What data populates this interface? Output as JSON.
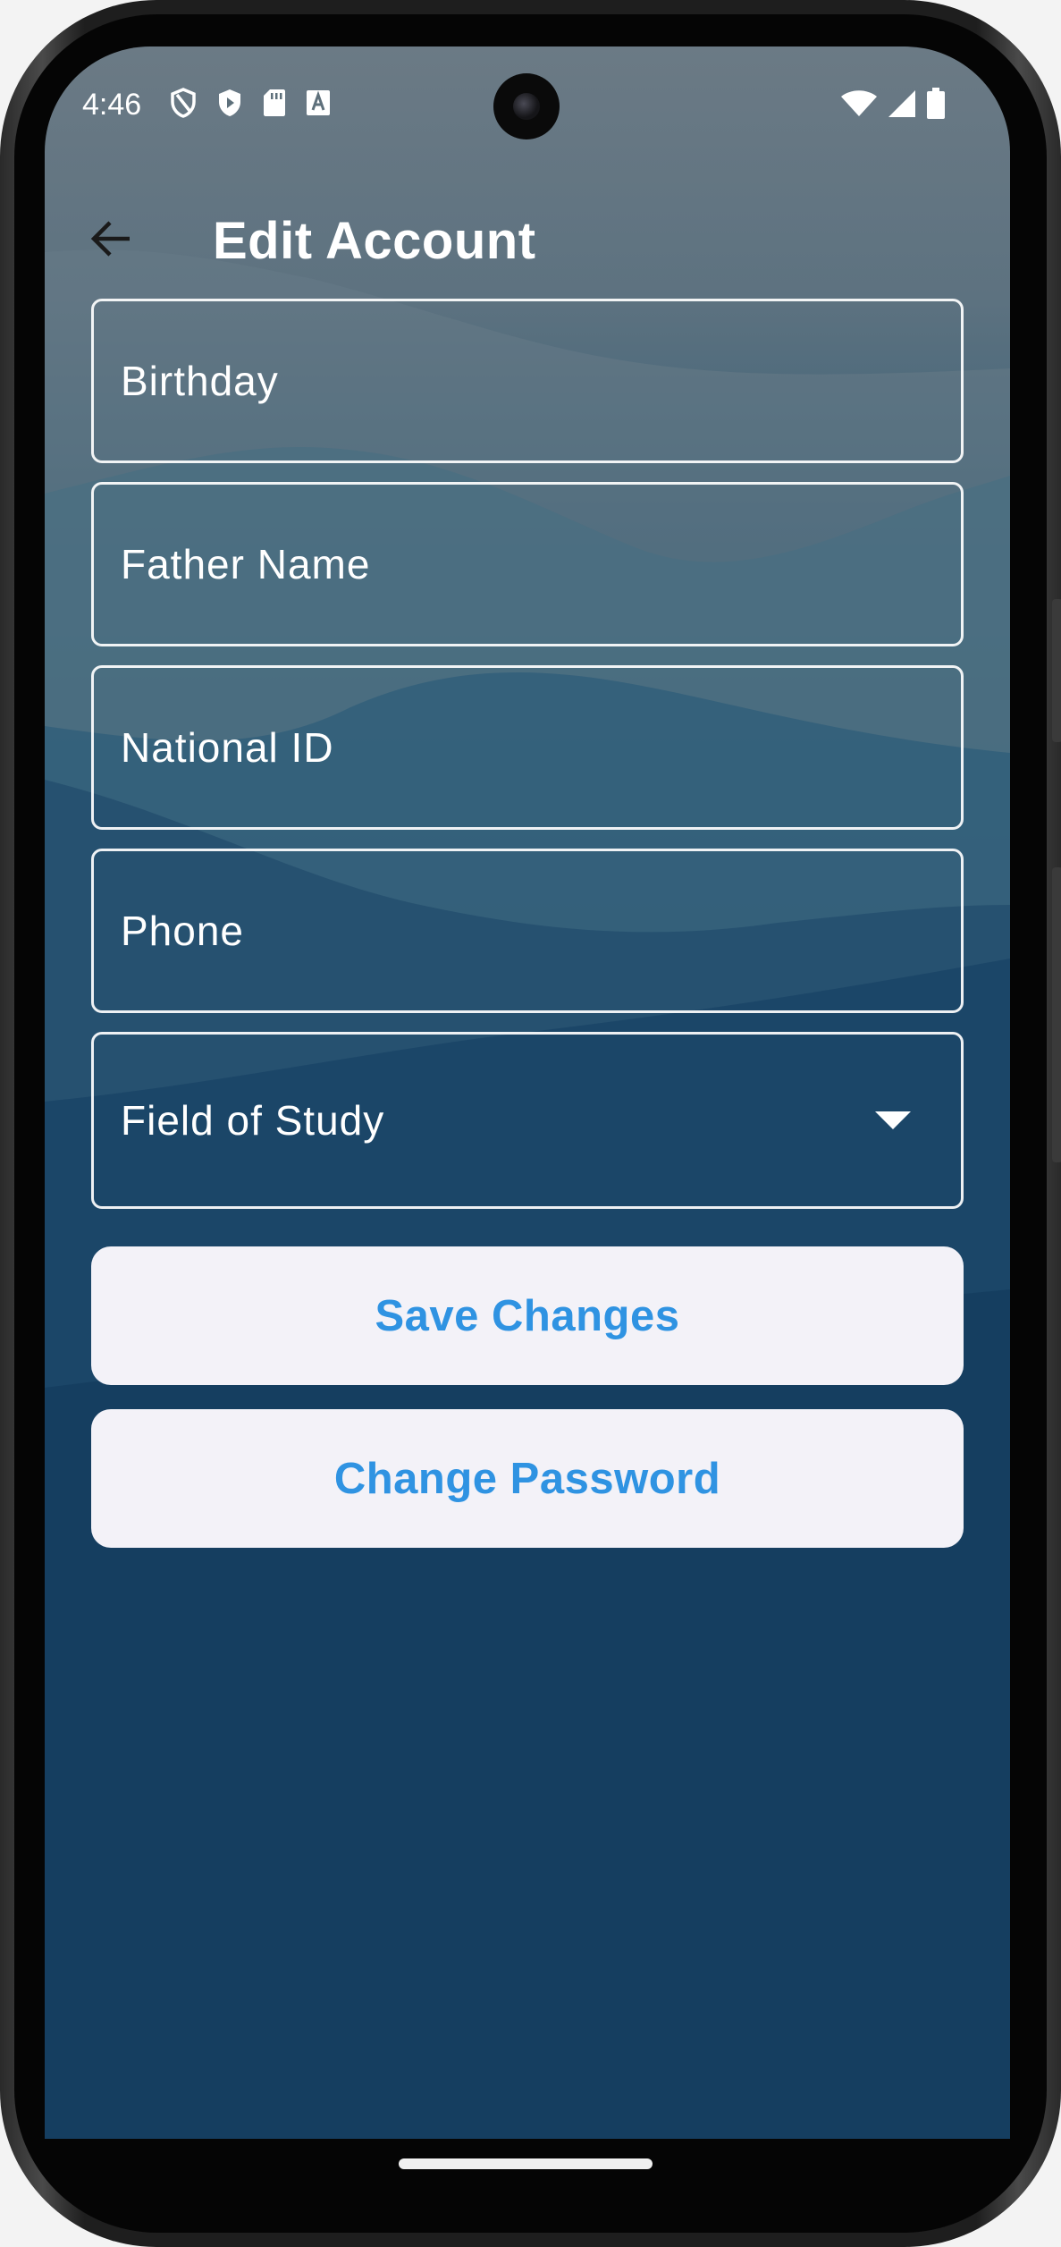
{
  "status_bar": {
    "time": "4:46",
    "left_icons": [
      "shield-outline-icon",
      "shield-play-icon",
      "sd-card-icon",
      "text-a-icon"
    ],
    "right_icons": [
      "wifi-icon",
      "cellular-signal-icon",
      "battery-icon"
    ]
  },
  "app_bar": {
    "title": "Edit Account",
    "back_icon": "arrow-left-icon"
  },
  "form": {
    "fields": [
      {
        "label": "Birthday",
        "value": ""
      },
      {
        "label": "Father Name",
        "value": ""
      },
      {
        "label": "National ID",
        "value": ""
      },
      {
        "label": "Phone",
        "value": ""
      }
    ],
    "dropdown": {
      "label": "Field of Study",
      "icon": "caret-down-icon"
    }
  },
  "buttons": {
    "save_label": "Save Changes",
    "change_password_label": "Change Password"
  },
  "colors": {
    "accent": "#2f93e2",
    "button_bg": "#f3f2f8",
    "text_on_bg": "#ffffff"
  }
}
